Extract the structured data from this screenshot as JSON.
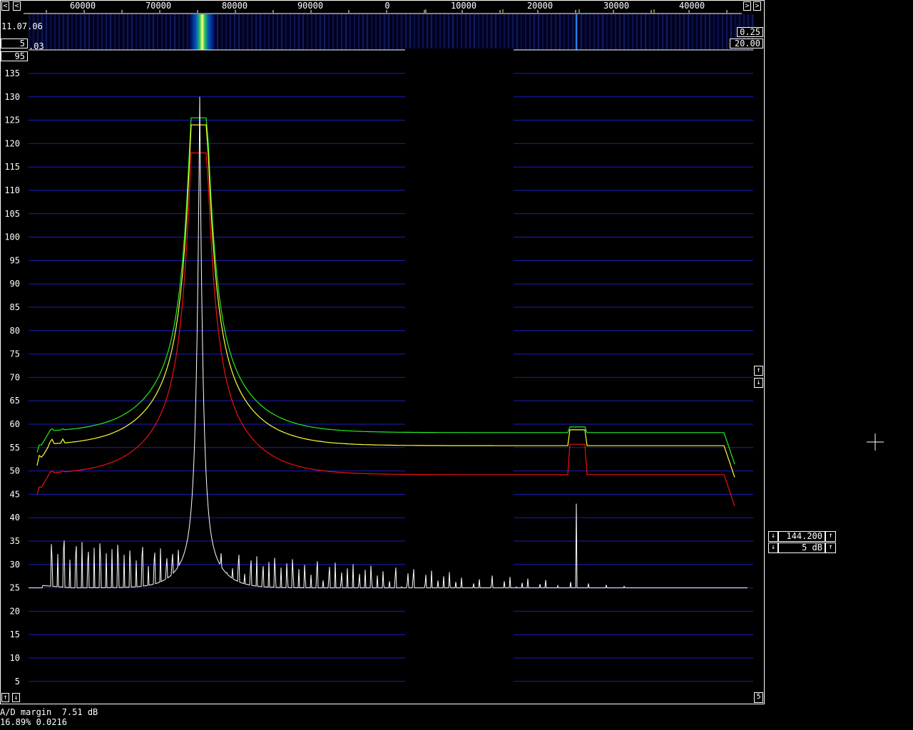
{
  "freq_scale": {
    "labels": [
      "60000",
      "70000",
      "80000",
      "90000",
      "0",
      "10000",
      "20000",
      "30000",
      "40000"
    ],
    "nav_left": "<",
    "nav_right": ">"
  },
  "waterfall": {
    "time_label": "11.07.06",
    "averages": "5",
    "left_value": ".03",
    "right_value_top": "0.25",
    "right_value_bottom": "20.00",
    "top_db": "95"
  },
  "spectrum": {
    "y_axis_labels": [
      "135",
      "130",
      "125",
      "120",
      "115",
      "110",
      "105",
      "100",
      "95",
      "90",
      "85",
      "80",
      "75",
      "70",
      "65",
      "60",
      "55",
      "50",
      "45",
      "40",
      "35",
      "30",
      "25",
      "20",
      "15",
      "10",
      "5"
    ],
    "grid_color": "#1c1cc0",
    "trace_colors": {
      "green": "#22ee22",
      "yellow": "#ffff33",
      "red": "#ee1111",
      "white": "#ffffff"
    }
  },
  "right_panel": {
    "frequency": "144.200",
    "db_per_div": "5 dB",
    "scale_value": "5"
  },
  "status": {
    "ad_margin": "A/D margin  7.51 dB",
    "cpu_line": "16.89% 0.0216"
  },
  "icons": {
    "arrow_up": "↑",
    "arrow_down": "↓",
    "cursor": "crosshair-icon"
  }
}
